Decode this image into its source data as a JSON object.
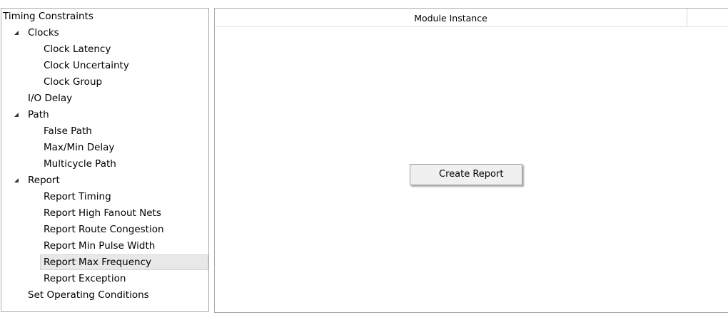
{
  "tree": {
    "items": [
      {
        "label": "Timing Constraints",
        "level": 0,
        "expander": "none"
      },
      {
        "label": "Clocks",
        "level": 1,
        "expander": "expanded"
      },
      {
        "label": "Clock Latency",
        "level": 2,
        "expander": "none"
      },
      {
        "label": "Clock Uncertainty",
        "level": 2,
        "expander": "none"
      },
      {
        "label": "Clock Group",
        "level": 2,
        "expander": "none"
      },
      {
        "label": "I/O Delay",
        "level": 1,
        "expander": "none"
      },
      {
        "label": "Path",
        "level": 1,
        "expander": "expanded"
      },
      {
        "label": "False Path",
        "level": 2,
        "expander": "none"
      },
      {
        "label": "Max/Min Delay",
        "level": 2,
        "expander": "none"
      },
      {
        "label": "Multicycle Path",
        "level": 2,
        "expander": "none"
      },
      {
        "label": "Report",
        "level": 1,
        "expander": "expanded"
      },
      {
        "label": "Report Timing",
        "level": 2,
        "expander": "none"
      },
      {
        "label": "Report High Fanout Nets",
        "level": 2,
        "expander": "none"
      },
      {
        "label": "Report Route Congestion",
        "level": 2,
        "expander": "none"
      },
      {
        "label": "Report Min Pulse Width",
        "level": 2,
        "expander": "none"
      },
      {
        "label": "Report Max Frequency",
        "level": 2,
        "expander": "none",
        "selected": true
      },
      {
        "label": "Report Exception",
        "level": 2,
        "expander": "none"
      },
      {
        "label": "Set Operating Conditions",
        "level": 1,
        "expander": "none"
      }
    ]
  },
  "main": {
    "column_header": "Module Instance"
  },
  "context_menu": {
    "create_report_label": "Create Report"
  },
  "colors": {
    "border": "#a9a9a9",
    "selection_bg": "#e8e8e8",
    "menu_bg": "#f0f0f0"
  }
}
